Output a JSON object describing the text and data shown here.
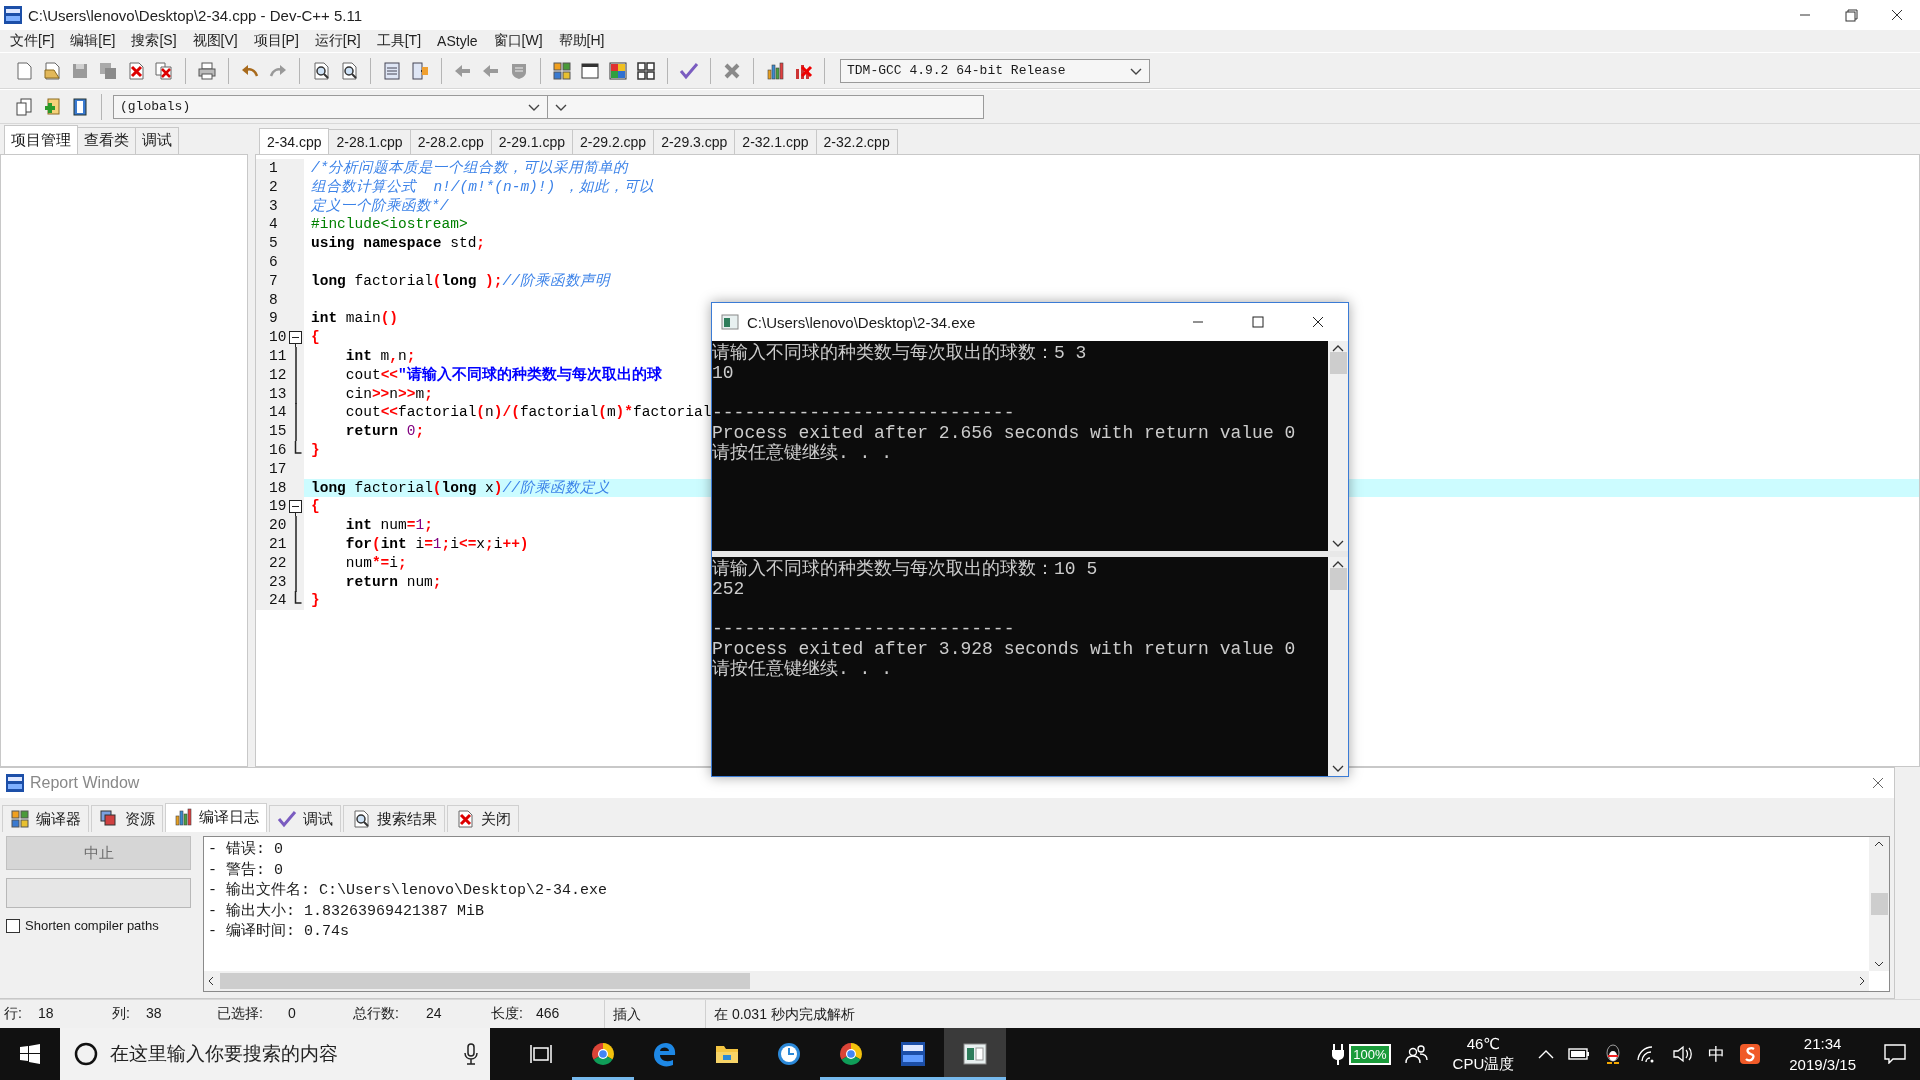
{
  "window": {
    "title": "C:\\Users\\lenovo\\Desktop\\2-34.cpp - Dev-C++ 5.11"
  },
  "menu": [
    "文件[F]",
    "编辑[E]",
    "搜索[S]",
    "视图[V]",
    "项目[P]",
    "运行[R]",
    "工具[T]",
    "AStyle",
    "窗口[W]",
    "帮助[H]"
  ],
  "toolbar": {
    "compiler": "TDM-GCC 4.9.2 64-bit Release",
    "scope": "(globals)"
  },
  "side_tabs": [
    {
      "label": "项目管理",
      "selected": true
    },
    {
      "label": "查看类",
      "selected": false
    },
    {
      "label": "调试",
      "selected": false
    }
  ],
  "editor_tabs": [
    {
      "label": "2-34.cpp",
      "selected": true
    },
    {
      "label": "2-28.1.cpp",
      "selected": false
    },
    {
      "label": "2-28.2.cpp",
      "selected": false
    },
    {
      "label": "2-29.1.cpp",
      "selected": false
    },
    {
      "label": "2-29.2.cpp",
      "selected": false
    },
    {
      "label": "2-29.3.cpp",
      "selected": false
    },
    {
      "label": "2-32.1.cpp",
      "selected": false
    },
    {
      "label": "2-32.2.cpp",
      "selected": false
    }
  ],
  "code": {
    "lines": [
      {
        "number": "1",
        "kind": "plain",
        "current": false,
        "tokens": [
          {
            "kind": "comment",
            "text": "/*分析问题本质是一个组合数，可以采用简单的"
          }
        ]
      },
      {
        "number": "2",
        "kind": "plain",
        "current": false,
        "tokens": [
          {
            "kind": "comment",
            "text": "组合数计算公式  n!/(m!*(n-m)!) ，如此，可以"
          }
        ]
      },
      {
        "number": "3",
        "kind": "plain",
        "current": false,
        "tokens": [
          {
            "kind": "comment",
            "text": "定义一个阶乘函数*/"
          }
        ]
      },
      {
        "number": "4",
        "kind": "plain",
        "current": false,
        "tokens": [
          {
            "kind": "preproc",
            "text": "#include<iostream>"
          }
        ]
      },
      {
        "number": "5",
        "kind": "plain",
        "current": false,
        "tokens": [
          {
            "kind": "keyword",
            "text": "using namespace"
          },
          {
            "kind": "plain",
            "text": " std"
          },
          {
            "kind": "symbol",
            "text": ";"
          }
        ]
      },
      {
        "number": "6",
        "kind": "plain",
        "current": false
      },
      {
        "number": "7",
        "kind": "plain",
        "current": false,
        "tokens": [
          {
            "kind": "keyword",
            "text": "long"
          },
          {
            "kind": "plain",
            "text": " factorial"
          },
          {
            "kind": "symbol",
            "text": "("
          },
          {
            "kind": "keyword",
            "text": "long "
          },
          {
            "kind": "symbol",
            "text": ");"
          },
          {
            "kind": "comment",
            "text": "//阶乘函数声明"
          }
        ]
      },
      {
        "number": "8",
        "kind": "plain",
        "current": false
      },
      {
        "number": "9",
        "kind": "plain",
        "current": false,
        "tokens": [
          {
            "kind": "keyword",
            "text": "int"
          },
          {
            "kind": "plain",
            "text": " main"
          },
          {
            "kind": "symbol",
            "text": "()"
          }
        ]
      },
      {
        "number": "10",
        "kind": "fold_start",
        "current": false,
        "tokens": [
          {
            "kind": "symbol",
            "text": "{"
          }
        ]
      },
      {
        "number": "11",
        "kind": "fold_body",
        "current": false,
        "tokens": [
          {
            "kind": "keyword",
            "text": "    int"
          },
          {
            "kind": "plain",
            "text": " m"
          },
          {
            "kind": "symbol",
            "text": ","
          },
          {
            "kind": "plain",
            "text": "n"
          },
          {
            "kind": "symbol",
            "text": ";"
          }
        ]
      },
      {
        "number": "12",
        "kind": "fold_body",
        "current": false,
        "tokens": [
          {
            "kind": "plain",
            "text": "    cout"
          },
          {
            "kind": "symbol",
            "text": "<<"
          },
          {
            "kind": "string",
            "text": "\"请输入不同球的种类数与每次取出的球"
          }
        ]
      },
      {
        "number": "13",
        "kind": "fold_body",
        "current": false,
        "tokens": [
          {
            "kind": "plain",
            "text": "    cin"
          },
          {
            "kind": "symbol",
            "text": ">>"
          },
          {
            "kind": "plain",
            "text": "n"
          },
          {
            "kind": "symbol",
            "text": ">>"
          },
          {
            "kind": "plain",
            "text": "m"
          },
          {
            "kind": "symbol",
            "text": ";"
          }
        ]
      },
      {
        "number": "14",
        "kind": "fold_body",
        "current": false,
        "tokens": [
          {
            "kind": "plain",
            "text": "    cout"
          },
          {
            "kind": "symbol",
            "text": "<<"
          },
          {
            "kind": "plain",
            "text": "factorial"
          },
          {
            "kind": "symbol",
            "text": "("
          },
          {
            "kind": "plain",
            "text": "n"
          },
          {
            "kind": "symbol",
            "text": ")/("
          },
          {
            "kind": "plain",
            "text": "factorial"
          },
          {
            "kind": "symbol",
            "text": "("
          },
          {
            "kind": "plain",
            "text": "m"
          },
          {
            "kind": "symbol",
            "text": ")*"
          },
          {
            "kind": "plain",
            "text": "factorial"
          }
        ]
      },
      {
        "number": "15",
        "kind": "fold_body",
        "current": false,
        "tokens": [
          {
            "kind": "keyword",
            "text": "    return "
          },
          {
            "kind": "number",
            "text": "0"
          },
          {
            "kind": "symbol",
            "text": ";"
          }
        ]
      },
      {
        "number": "16",
        "kind": "fold_end",
        "current": false,
        "tokens": [
          {
            "kind": "symbol",
            "text": "}"
          }
        ]
      },
      {
        "number": "17",
        "kind": "plain",
        "current": false
      },
      {
        "number": "18",
        "kind": "plain",
        "current": true,
        "tokens": [
          {
            "kind": "keyword",
            "text": "long"
          },
          {
            "kind": "plain",
            "text": " factorial"
          },
          {
            "kind": "symbol",
            "text": "("
          },
          {
            "kind": "keyword",
            "text": "long"
          },
          {
            "kind": "plain",
            "text": " x"
          },
          {
            "kind": "symbol",
            "text": ")"
          },
          {
            "kind": "comment",
            "text": "//阶乘函数定义"
          }
        ]
      },
      {
        "number": "19",
        "kind": "fold_start",
        "current": false,
        "tokens": [
          {
            "kind": "symbol",
            "text": "{"
          }
        ]
      },
      {
        "number": "20",
        "kind": "fold_body",
        "current": false,
        "tokens": [
          {
            "kind": "keyword",
            "text": "    int"
          },
          {
            "kind": "plain",
            "text": " num"
          },
          {
            "kind": "symbol",
            "text": "="
          },
          {
            "kind": "number",
            "text": "1"
          },
          {
            "kind": "symbol",
            "text": ";"
          }
        ]
      },
      {
        "number": "21",
        "kind": "fold_body",
        "current": false,
        "tokens": [
          {
            "kind": "keyword",
            "text": "    for"
          },
          {
            "kind": "symbol",
            "text": "("
          },
          {
            "kind": "keyword",
            "text": "int"
          },
          {
            "kind": "plain",
            "text": " i"
          },
          {
            "kind": "symbol",
            "text": "="
          },
          {
            "kind": "number",
            "text": "1"
          },
          {
            "kind": "symbol",
            "text": ";"
          },
          {
            "kind": "plain",
            "text": "i"
          },
          {
            "kind": "symbol",
            "text": "<="
          },
          {
            "kind": "plain",
            "text": "x"
          },
          {
            "kind": "symbol",
            "text": ";"
          },
          {
            "kind": "plain",
            "text": "i"
          },
          {
            "kind": "symbol",
            "text": "++)"
          }
        ]
      },
      {
        "number": "22",
        "kind": "fold_body",
        "current": false,
        "tokens": [
          {
            "kind": "plain",
            "text": "    num"
          },
          {
            "kind": "symbol",
            "text": "*="
          },
          {
            "kind": "plain",
            "text": "i"
          },
          {
            "kind": "symbol",
            "text": ";"
          }
        ]
      },
      {
        "number": "23",
        "kind": "fold_body",
        "current": false,
        "tokens": [
          {
            "kind": "keyword",
            "text": "    return"
          },
          {
            "kind": "plain",
            "text": " num"
          },
          {
            "kind": "symbol",
            "text": ";"
          }
        ]
      },
      {
        "number": "24",
        "kind": "fold_end",
        "current": false,
        "tokens": [
          {
            "kind": "symbol",
            "text": "}"
          }
        ]
      }
    ]
  },
  "console": {
    "title": "C:\\Users\\lenovo\\Desktop\\2-34.exe",
    "panes": [
      {
        "output": [
          "请输入不同球的种类数与每次取出的球数：5 3",
          "10"
        ],
        "footer": [
          "----------------------------",
          "Process exited after 2.656 seconds with return value 0",
          "请按任意键继续. . ."
        ]
      },
      {
        "output": [
          "请输入不同球的种类数与每次取出的球数：10 5",
          "252"
        ],
        "footer": [
          "----------------------------",
          "Process exited after 3.928 seconds with return value 0",
          "请按任意键继续. . ."
        ]
      }
    ]
  },
  "report": {
    "title": "Report Window",
    "tabs": [
      {
        "kind": "grid",
        "label": "编译器",
        "selected": false
      },
      {
        "kind": "resources",
        "label": "资源",
        "selected": false
      },
      {
        "kind": "chart",
        "label": "编译日志",
        "selected": true
      },
      {
        "kind": "check",
        "label": "调试",
        "selected": false
      },
      {
        "kind": "search",
        "label": "搜索结果",
        "selected": false
      },
      {
        "kind": "close",
        "label": "关闭",
        "selected": false
      }
    ],
    "stop_button": {
      "label": "中止",
      "disabled": true
    },
    "progress": {
      "level": 0
    },
    "shorten_paths": {
      "label": "Shorten compiler paths",
      "checked": false
    },
    "log": [
      "- 错误: 0",
      "- 警告: 0",
      "- 输出文件名: C:\\Users\\lenovo\\Desktop\\2-34.exe",
      "- 输出大小: 1.83263969421387 MiB",
      "- 编译时间: 0.74s"
    ]
  },
  "status_bar": {
    "fields": [
      {
        "label": "行:",
        "value": "18"
      },
      {
        "label": "列:",
        "value": "38"
      },
      {
        "label": "已选择:",
        "value": "0"
      },
      {
        "label": "总行数:",
        "value": "24"
      },
      {
        "label": "长度:",
        "value": "466"
      }
    ],
    "panels": [
      "插入",
      "在 0.031 秒内完成解析"
    ]
  },
  "taskbar": {
    "search": {
      "placeholder": "在这里输入你要搜索的内容"
    },
    "apps": [
      {
        "kind": "chrome",
        "running": true,
        "active": false
      },
      {
        "kind": "edge",
        "running": false,
        "active": false
      },
      {
        "kind": "explorer",
        "running": false,
        "active": false
      },
      {
        "kind": "clock",
        "running": false,
        "active": false
      },
      {
        "kind": "chrome",
        "running": true,
        "active": false
      },
      {
        "kind": "devcpp",
        "running": true,
        "active": false
      },
      {
        "kind": "console",
        "running": true,
        "active": true
      }
    ],
    "battery": "100%",
    "temperature": "46℃",
    "temperature_label": "CPU温度",
    "ime": "中",
    "time": "21:34",
    "date": "2019/3/15"
  }
}
